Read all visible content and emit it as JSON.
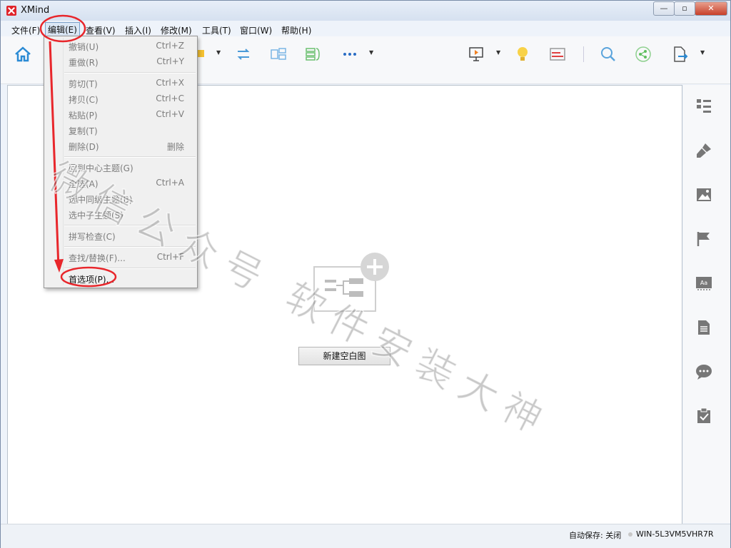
{
  "window": {
    "title": "XMind"
  },
  "menubar": {
    "items": [
      {
        "label": "文件(F)"
      },
      {
        "label": "编辑(E)"
      },
      {
        "label": "查看(V)"
      },
      {
        "label": "插入(I)"
      },
      {
        "label": "修改(M)"
      },
      {
        "label": "工具(T)"
      },
      {
        "label": "窗口(W)"
      },
      {
        "label": "帮助(H)"
      }
    ]
  },
  "edit_menu": {
    "items": [
      {
        "label": "撤销(U)",
        "shortcut": "Ctrl+Z"
      },
      {
        "label": "重做(R)",
        "shortcut": "Ctrl+Y"
      },
      {
        "label": "剪切(T)",
        "shortcut": "Ctrl+X"
      },
      {
        "label": "拷贝(C)",
        "shortcut": "Ctrl+C"
      },
      {
        "label": "粘贴(P)",
        "shortcut": "Ctrl+V"
      },
      {
        "label": "复制(T)",
        "shortcut": ""
      },
      {
        "label": "删除(D)",
        "shortcut": "删除"
      },
      {
        "label": "回到中心主题(G)",
        "shortcut": ""
      },
      {
        "label": "全选(A)",
        "shortcut": "Ctrl+A"
      },
      {
        "label": "选中同级主题(B)",
        "shortcut": ""
      },
      {
        "label": "选中子主题(S)",
        "shortcut": ""
      },
      {
        "label": "拼写检查(C)",
        "shortcut": ""
      },
      {
        "label": "查找/替换(F)...",
        "shortcut": "Ctrl+F"
      },
      {
        "label": "首选项(P)...",
        "shortcut": ""
      }
    ]
  },
  "canvas": {
    "new_blank_map_label": "新建空白图"
  },
  "statusbar": {
    "autosave": "自动保存: 关闭",
    "user": "WIN-5L3VM5VHR7R"
  },
  "watermark": {
    "text": "微信公众号 软件安装大神"
  },
  "colors": {
    "accent": "#2a8ad4",
    "annotation_red": "#e8262b",
    "window_chrome": "#dfe8f4"
  },
  "toolbar_icons": [
    "home-icon",
    "topic-icon",
    "relationship-icon",
    "boundary-icon",
    "summary-icon",
    "more-icon",
    "presentation-icon",
    "brainstorm-icon",
    "gantt-icon",
    "search-icon",
    "share-icon",
    "export-icon"
  ],
  "sidebar_icons": [
    "outline-icon",
    "format-icon",
    "image-icon",
    "marker-icon",
    "label-icon",
    "notes-icon",
    "comments-icon",
    "task-icon"
  ]
}
